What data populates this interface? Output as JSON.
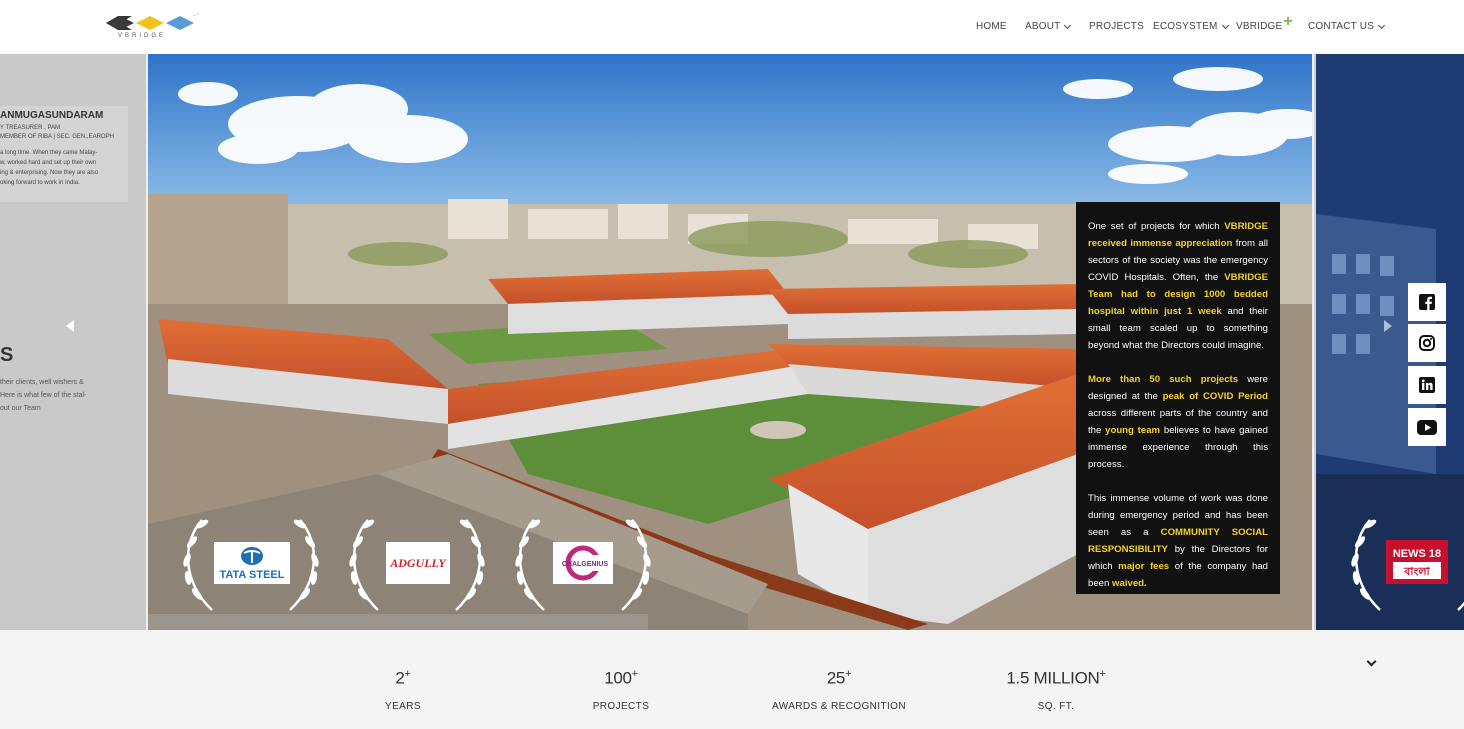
{
  "brand": {
    "logo_text": "VBRIDGE"
  },
  "nav": {
    "items": [
      {
        "label": "HOME",
        "dropdown": false
      },
      {
        "label": "ABOUT",
        "dropdown": true
      },
      {
        "label": "PROJECTS",
        "dropdown": false
      },
      {
        "label": "ECOSYSTEM",
        "dropdown": true
      },
      {
        "label": "VBRIDGE",
        "suffix": "+"
      },
      {
        "label": "CONTACT US",
        "dropdown": true
      }
    ]
  },
  "left_slide": {
    "name": "ANMUGASUNDARAM",
    "sub_line1": "Y TREASURER , PAM",
    "sub_line2": "MEMBER OF RIBA | SEC. GEN.,EAROPH",
    "quote_line1": "a long time. When they came Malay-",
    "quote_line2": "w, worked hard and set up their own",
    "quote_line3": "ing & enterprising. Now they are also",
    "quote_line4": "oking forward to work in India.",
    "heading_fragment": "S",
    "clients_line1": "their clients, well wishers &",
    "clients_line2": "Here is what few of the stal-",
    "clients_line3": "out our Team"
  },
  "info_box": {
    "p1": [
      {
        "t": "One set of projects for which "
      },
      {
        "t": "VBRIDGE received immense appreciation",
        "hl": true
      },
      {
        "t": " from all sectors of the society was the emergency COVID Hospitals. Often, the "
      },
      {
        "t": "VBRIDGE Team had to design 1000 bedded hospital within just 1 week",
        "hl": true
      },
      {
        "t": " and their small team scaled up to something beyond what the Directors could imagine."
      }
    ],
    "p2": [
      {
        "t": "More than 50 such projects",
        "hl": true
      },
      {
        "t": " were designed at the "
      },
      {
        "t": "peak of COVID Period",
        "hl": true
      },
      {
        "t": " across different parts of the country and the "
      },
      {
        "t": "young team",
        "hl": true
      },
      {
        "t": " believes to have gained immense experience through this process."
      }
    ],
    "p3": [
      {
        "t": "This immense volume of work was done during emergency period and has been seen as a "
      },
      {
        "t": "COMMUNITY SOCIAL RESPONSIBILITY",
        "hl": true
      },
      {
        "t": " by the Directors for which "
      },
      {
        "t": "major fees",
        "hl": true
      },
      {
        "t": " of the company had been "
      },
      {
        "t": "waived.",
        "hl": true
      }
    ]
  },
  "awards": [
    {
      "name": "TATA STEEL"
    },
    {
      "name": "ADGULLY"
    },
    {
      "name": "CHALGENIUS"
    }
  ],
  "right_award": {
    "name": "NEWS 18",
    "sub": "বাংলা"
  },
  "social": [
    "facebook",
    "instagram",
    "linkedin",
    "youtube"
  ],
  "stats": [
    {
      "value": "2",
      "plus": "+",
      "label": "YEARS"
    },
    {
      "value": "100",
      "plus": "+",
      "label": "PROJECTS"
    },
    {
      "value": "25",
      "plus": "+",
      "label": "AWARDS & RECOGNITION"
    },
    {
      "value": "1.5 MILLION",
      "plus": "+",
      "label": "SQ. FT."
    }
  ],
  "colors": {
    "accent": "#f5d21d",
    "plus_green": "#7ab648",
    "roof": "#d4602b"
  }
}
